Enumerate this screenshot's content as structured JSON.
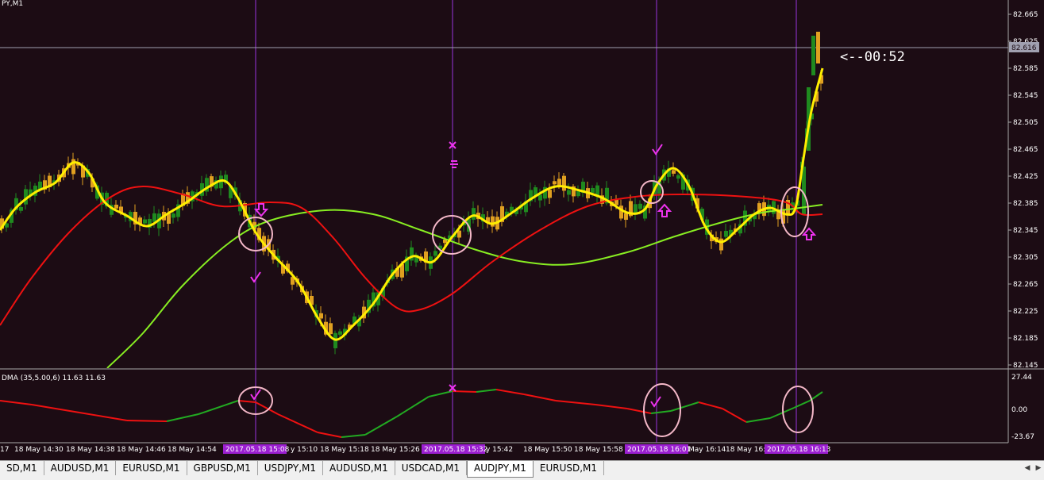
{
  "window": {
    "title": "PY,M1",
    "timer": "<--00:52",
    "current_price": "82.616"
  },
  "indicator": {
    "label": "DMA (35,5.00,6) 11.63 11.63",
    "scale": [
      "27.44",
      "0.00",
      "-23.67"
    ]
  },
  "price_scale": [
    "82.665",
    "82.625",
    "82.585",
    "82.545",
    "82.505",
    "82.465",
    "82.425",
    "82.385",
    "82.345",
    "82.305",
    "82.265",
    "82.225",
    "82.185",
    "82.145"
  ],
  "time_axis": {
    "labels": [
      "17",
      "18 May 14:30",
      "18 May 14:38",
      "18 May 14:46",
      "18 May 14:54",
      "y 15:10",
      "18 May 15:18",
      "18 May 15:26",
      "y 15:42",
      "18 May 15:50",
      "18 May 15:58",
      "May 16:14",
      "18 May 16:"
    ],
    "highlights": [
      "2017.05.18 15:08",
      "2017.05.18 15:32",
      "2017.05.18 16:01",
      "2017.05.18 16:13"
    ]
  },
  "tabs": [
    "SD,M1",
    "AUDUSD,M1",
    "EURUSD,M1",
    "GBPUSD,M1",
    "USDJPY,M1",
    "AUDUSD,M1",
    "USDCAD,M1",
    "AUDJPY,M1",
    "EURUSD,M1"
  ],
  "active_tab": "AUDJPY,M1",
  "colors": {
    "background": "#1c0c14",
    "bull": "#1f8a1f",
    "bear": "#e0a020",
    "ma_yellow": "#ffee00",
    "ma_red": "#ee1111",
    "ma_green": "#88ee22",
    "vline": "#9933dd",
    "circle": "#f4b8c8",
    "marker": "#ee33ee"
  },
  "icons": [
    "check-mark-icon",
    "cross-mark-icon",
    "arrow-up-icon",
    "arrow-down-icon",
    "scroll-left-icon",
    "scroll-right-icon"
  ]
}
